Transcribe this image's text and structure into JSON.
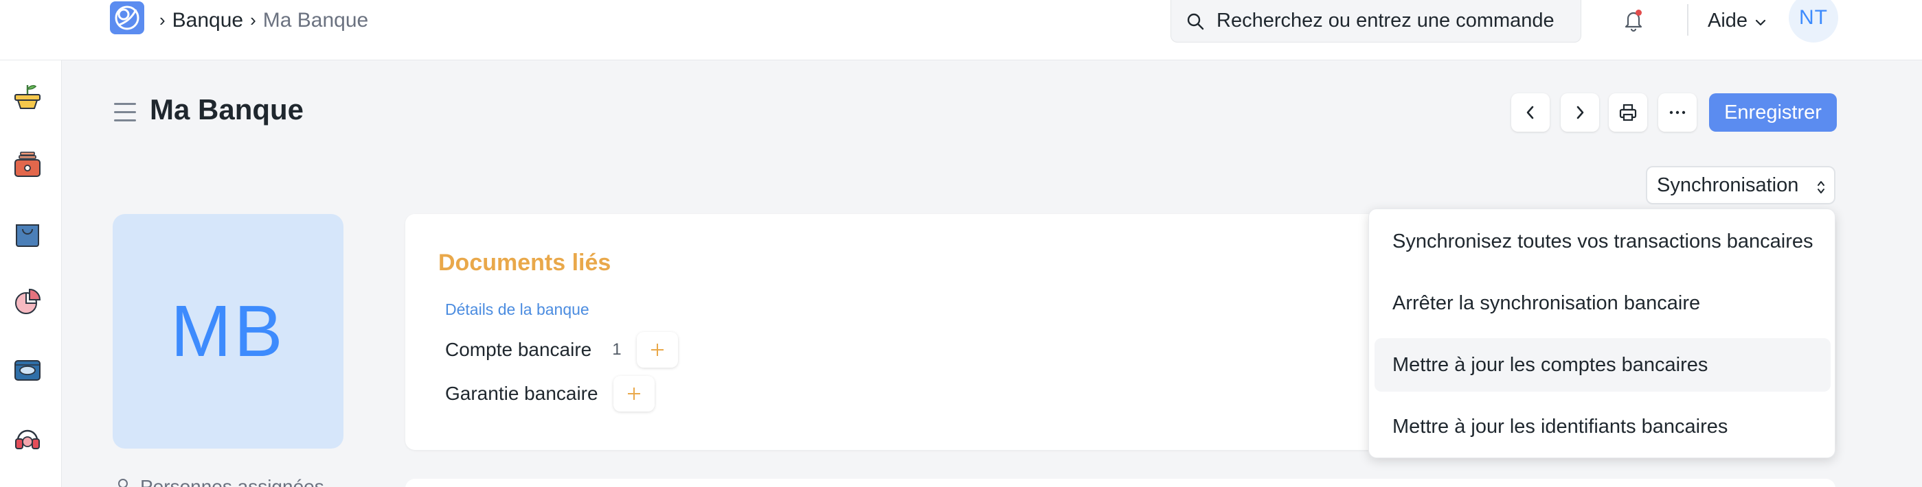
{
  "navbar": {
    "breadcrumbs": [
      "Banque",
      "Ma Banque"
    ],
    "search_placeholder": "Recherchez ou entrez une commande",
    "help_label": "Aide",
    "user_initials": "NT"
  },
  "page": {
    "title": "Ma Banque",
    "save_label": "Enregistrer",
    "sync_select_label": "Synchronisation",
    "avatar_initials": "MB",
    "assigned_label": "Personnes assignées"
  },
  "linked_documents": {
    "title": "Documents liés",
    "section_label": "Détails de la banque",
    "rows": [
      {
        "label": "Compte bancaire",
        "count": "1"
      },
      {
        "label": "Garantie bancaire",
        "count": ""
      }
    ]
  },
  "sync_menu": {
    "items": [
      {
        "label": "Synchronisez toutes vos transactions bancaires"
      },
      {
        "label": "Arrêter la synchronisation bancaire"
      },
      {
        "label": "Mettre à jour les comptes bancaires",
        "hovered": true
      },
      {
        "label": "Mettre à jour les identifiants bancaires"
      }
    ]
  },
  "sidebar_icons": [
    "plant-pot-icon",
    "toolbox-icon",
    "shopping-bag-icon",
    "pie-chart-icon",
    "monitor-icon",
    "headset-icon"
  ],
  "colors": {
    "primary": "#5b8cf0",
    "accent_orange": "#e9a84a",
    "link_blue": "#4b8ce0",
    "avatar_bg": "#d6e6fa",
    "notification_dot": "#e24c4c"
  }
}
